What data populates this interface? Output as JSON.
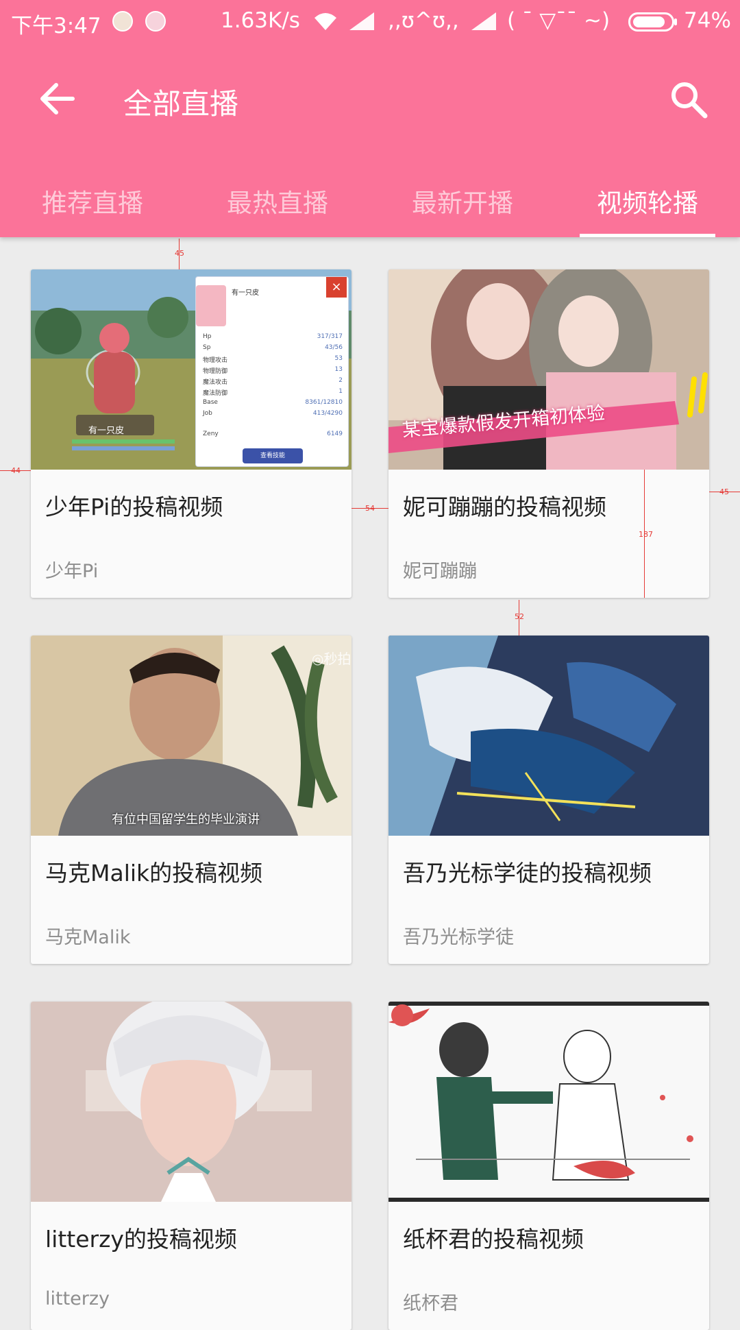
{
  "status_bar": {
    "time": "下午3:47",
    "network_speed": "1.63K/s",
    "carrier1": ",,ʊ^ʊ,,",
    "carrier2": "( ¯ ▽¯¯ ~)",
    "battery": "74%"
  },
  "toolbar": {
    "title": "全部直播"
  },
  "tabs": [
    {
      "label": "推荐直播",
      "active": false
    },
    {
      "label": "最热直播",
      "active": false
    },
    {
      "label": "最新开播",
      "active": false
    },
    {
      "label": "视频轮播",
      "active": true
    }
  ],
  "cards": [
    {
      "title": "少年Pi的投稿视频",
      "author": "少年Pi",
      "thumb_caption": "有一只皮"
    },
    {
      "title": "妮可蹦蹦的投稿视频",
      "author": "妮可蹦蹦",
      "thumb_caption": "某宝爆款假发开箱初体验"
    },
    {
      "title": "马克Malik的投稿视频",
      "author": "马克Malik",
      "thumb_caption": "有位中国留学生的毕业演讲"
    },
    {
      "title": "吾乃光标学徒的投稿视频",
      "author": "吾乃光标学徒",
      "thumb_caption": ""
    },
    {
      "title": "litterzy的投稿视频",
      "author": "litterzy",
      "thumb_caption": ""
    },
    {
      "title": "纸杯君的投稿视频",
      "author": "纸杯君",
      "thumb_caption": ""
    }
  ],
  "game_panel": {
    "name": "有一只皮",
    "rows": [
      {
        "label": "Hp",
        "value": "317/317"
      },
      {
        "label": "Sp",
        "value": "43/56"
      },
      {
        "label": "物理攻击",
        "value": "53"
      },
      {
        "label": "物理防御",
        "value": "13"
      },
      {
        "label": "魔法攻击",
        "value": "2"
      },
      {
        "label": "魔法防御",
        "value": "1"
      },
      {
        "label": "Base",
        "value": "8361/12810"
      },
      {
        "label": "Job",
        "value": "413/4290"
      }
    ],
    "zeny_label": "Zeny",
    "zeny_value": "6149",
    "button": "查看技能"
  },
  "thumb_watermark": "秒拍",
  "measurements": [
    "45",
    "44",
    "54",
    "187",
    "45",
    "52"
  ],
  "colors": {
    "primary": "#FB7399",
    "background": "#ECECEC",
    "card": "#FAFAFA",
    "title_text": "#222222",
    "author_text": "#8D8D8D",
    "measure": "#E53935"
  },
  "icons": {
    "back": "arrow-left",
    "search": "magnifier"
  }
}
